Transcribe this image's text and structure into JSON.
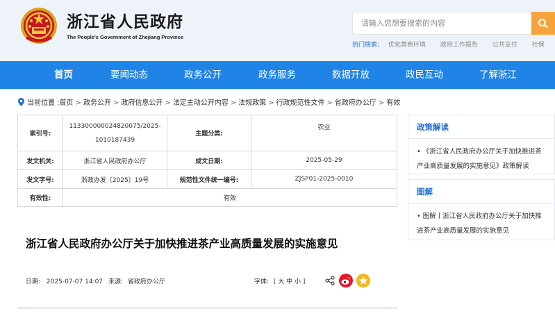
{
  "header": {
    "title": "浙江省人民政府",
    "subtitle": "The People's Government of Zhejiang Province",
    "search_placeholder": "请输入您想要搜索的内容",
    "hot_label": "热门搜索:",
    "hot_items": [
      "优化营商环境",
      "政府工作报告",
      "公共支付",
      "社保"
    ]
  },
  "nav": {
    "items": [
      "首页",
      "要闻动态",
      "政务公开",
      "政务服务",
      "数据开放",
      "政民互动",
      "了解浙江"
    ],
    "active": "首页"
  },
  "breadcrumb": {
    "prefix": "当前位置 :",
    "items": [
      "首页",
      "政务公开",
      "政府信息公开",
      "法定主动公开内容",
      "法规政策",
      "行政规范性文件",
      "省政府办公厅",
      "有效"
    ],
    "separator": ">"
  },
  "meta": {
    "index_label": "索引号:",
    "index_value": "113300000024820075/2025-1010187439",
    "subject_label": "主题分类:",
    "subject_value": "农业",
    "issuer_label": "发文机关:",
    "issuer_value": "浙江省人民政府办公厅",
    "date_label": "成文日期:",
    "date_value": "2025-05-29",
    "docno_label": "发文字号:",
    "docno_value": "浙政办发〔2025〕19号",
    "code_label": "规范性文件统一编号:",
    "code_value": "ZJSP01-2025-0010",
    "valid_label": "有效性:",
    "valid_value": "有效"
  },
  "sidebar": {
    "policy_head": "政策解读",
    "policy_link": "• 《浙江省人民政府办公厅关于加快推进茶产业高质量发展的实施意见》政策解读",
    "graphic_head": "图解",
    "graphic_link": "• 图解丨浙江省人民政府办公厅关于加快推进茶产业高质量发展的实施意见"
  },
  "article": {
    "title": "浙江省人民政府办公厅关于加快推进茶产业高质量发展的实施意见",
    "date_label": "日期:",
    "date_value": "2025-07-07 14:07",
    "source_label": "来源:",
    "source_value": "省政府办公厅",
    "font_label": "字体:",
    "font_options": "[ 大 中 小 ]"
  },
  "colors": {
    "nav_blue": "#1f84e6",
    "search_orange": "#f5a43b",
    "link_blue": "#1f6fd0",
    "weibo_red": "#e6162d",
    "qzone_yellow": "#f4b81c"
  },
  "icons": [
    "national-emblem-icon",
    "search-icon",
    "location-pin-icon",
    "share-icon",
    "weibo-icon",
    "qzone-icon"
  ]
}
